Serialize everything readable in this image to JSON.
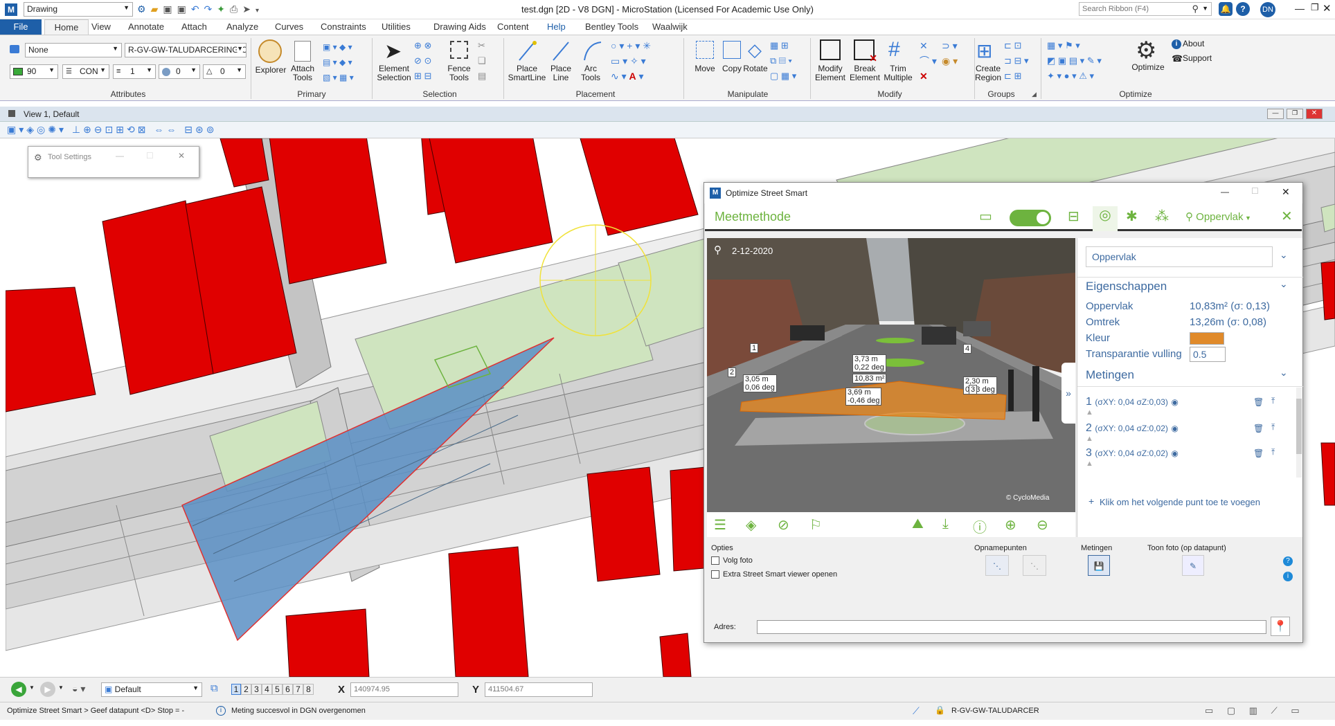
{
  "app": {
    "workflow": "Drawing",
    "title": "test.dgn [2D - V8 DGN] - MicroStation (Licensed For Academic Use Only)",
    "search_placeholder": "Search Ribbon (F4)",
    "user_initials": "DN"
  },
  "ribbon_tabs": [
    "File",
    "Home",
    "View",
    "Annotate",
    "Attach",
    "Analyze",
    "Curves",
    "Constraints",
    "Utilities",
    "Drawing Aids",
    "Content",
    "Help",
    "Bentley Tools",
    "Waalwijk"
  ],
  "attributes": {
    "level_none": "None",
    "level_name": "R-GV-GW-TALUDARCERING-C",
    "color": "90",
    "linestyle": "CON",
    "weight": "1",
    "transparency": "0",
    "priority": "0",
    "group_label": "Attributes"
  },
  "groups": {
    "primary": "Primary",
    "selection": "Selection",
    "placement": "Placement",
    "manipulate": "Manipulate",
    "modify": "Modify",
    "groups": "Groups",
    "optimize": "Optimize"
  },
  "buttons": {
    "explorer": "Explorer",
    "attach_tools": "Attach Tools",
    "element_selection": "Element Selection",
    "fence_tools": "Fence Tools",
    "place_smartline": "Place SmartLine",
    "place_line": "Place Line",
    "arc_tools": "Arc Tools",
    "move": "Move",
    "copy": "Copy",
    "rotate": "Rotate",
    "modify_element": "Modify Element",
    "break_element": "Break Element",
    "trim_multiple": "Trim Multiple",
    "create_region": "Create Region",
    "optimize": "Optimize",
    "about": "About",
    "support": "Support"
  },
  "view": {
    "title": "View 1, Default"
  },
  "tool_settings": {
    "title": "Tool Settings"
  },
  "ssw": {
    "window_title": "Optimize Street Smart",
    "header_title": "Meetmethode",
    "mode_label": "Oppervlak",
    "photo_date": "2-12-2020",
    "copyright": "© CycloMedia",
    "type_select": "Oppervlak",
    "props_title": "Eigenschappen",
    "props": [
      {
        "label": "Oppervlak",
        "value": "10,83m² (σ: 0,13)"
      },
      {
        "label": "Omtrek",
        "value": "13,26m (σ: 0,08)"
      },
      {
        "label": "Kleur",
        "value": ""
      },
      {
        "label": "Transparantie vulling",
        "value": "0.5"
      }
    ],
    "kleur_color": "#e08a2a",
    "measurements_title": "Metingen",
    "points": [
      {
        "num": "1",
        "detail": "(σXY: 0,04 σZ:0,03)"
      },
      {
        "num": "2",
        "detail": "(σXY: 0,04 σZ:0,02)"
      },
      {
        "num": "3",
        "detail": "(σXY: 0,04 σZ:0,02)"
      }
    ],
    "add_point": "Klik om het volgende punt toe te voegen",
    "photo_labels": {
      "l1": "3,73 m",
      "l1b": "0,22 deg",
      "l2": "3,05 m",
      "l2b": "0,06 deg",
      "l3": "10,83 m²",
      "l4": "3,69 m",
      "l4b": "-0,46 deg",
      "l5": "2,30 m",
      "l5b": "0,03 deg",
      "p1": "1",
      "p2": "2",
      "p3": "3",
      "p4": "4"
    },
    "options_title": "Opties",
    "opt_volg_foto": "Volg foto",
    "opt_extra_viewer": "Extra Street Smart viewer openen",
    "opnamepunten_title": "Opnamepunten",
    "metingen_title": "Metingen",
    "toon_foto_title": "Toon foto (op datapunt)",
    "adres_label": "Adres:",
    "adres_value": ""
  },
  "bottombar": {
    "view_group": "Default",
    "views": [
      "1",
      "2",
      "3",
      "4",
      "5",
      "6",
      "7",
      "8"
    ],
    "x_label": "X",
    "x_value": "140974.95",
    "y_label": "Y",
    "y_value": "411504.67"
  },
  "status": {
    "prompt": "Optimize Street Smart > Geef datapunt <D> Stop = -",
    "message": "Meting succesvol in DGN overgenomen",
    "active_level": "R-GV-GW-TALUDARCER"
  },
  "colors": {
    "accent": "#1e5fa8",
    "building": "#e00000",
    "green_area": "#cfe4bf",
    "measure_fill": "#5b8fc4",
    "ssw_green": "#6db33f"
  }
}
